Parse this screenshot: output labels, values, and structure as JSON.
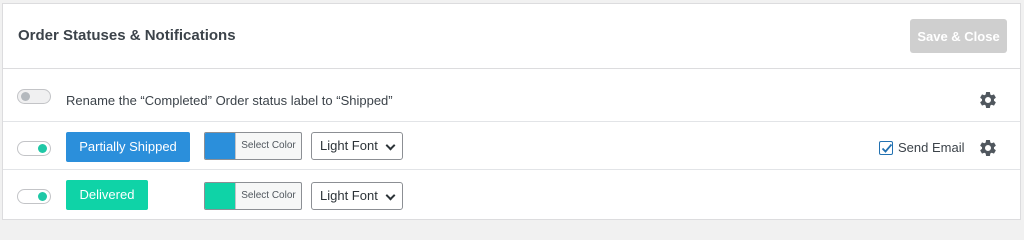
{
  "header": {
    "title": "Order Statuses & Notifications",
    "save_label": "Save & Close"
  },
  "rows": [
    {
      "toggle_on": false,
      "text": "Rename the “Completed” Order status label to “Shipped”",
      "has_settings": true
    },
    {
      "toggle_on": true,
      "status_label": "Partially Shipped",
      "status_color": "#2b8fdb",
      "color_picker_label": "Select Color",
      "font_option": "Light Font",
      "send_email_label": "Send Email",
      "send_email_checked": true,
      "has_settings": true
    },
    {
      "toggle_on": true,
      "status_label": "Delivered",
      "status_color": "#0fd3a7",
      "color_picker_label": "Select Color",
      "font_option": "Light Font"
    }
  ],
  "colors": {
    "accent_toggle": "#1fc8a6",
    "checkbox_blue": "#2271b1",
    "save_disabled": "#cfcfcf"
  },
  "icons": [
    "gear-icon",
    "check-icon",
    "chevron-down-icon"
  ]
}
